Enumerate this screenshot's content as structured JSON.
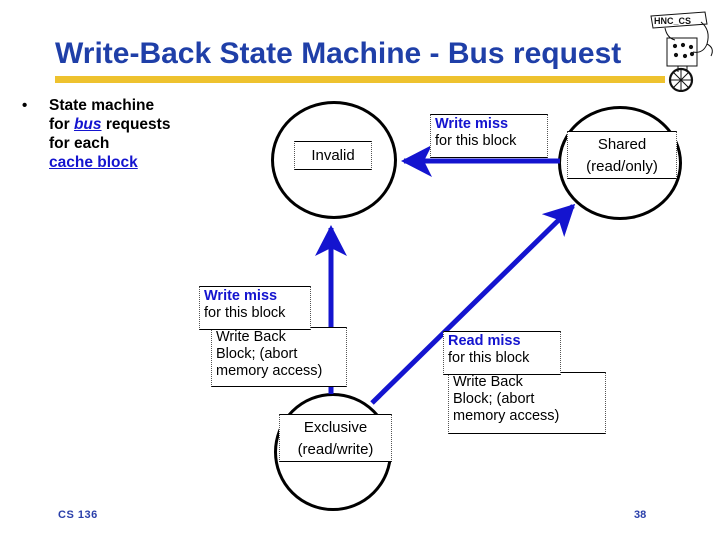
{
  "slide": {
    "title": "Write-Back State Machine - Bus request",
    "accent_rule_color": "#eec22e",
    "title_color": "#1f3fa8"
  },
  "logo": {
    "name": "hnc-cs-unicycle-logo",
    "caption": "HNC_CS"
  },
  "bullet": {
    "marker": "•",
    "line1": "State machine",
    "line2_pre": "for ",
    "line2_kw": "bus",
    "line2_post": " requests",
    "line3": " for each",
    "line4": "cache block"
  },
  "states": {
    "invalid": {
      "name": "Invalid"
    },
    "shared": {
      "line1": "Shared",
      "line2": "(read/only)"
    },
    "exclusive": {
      "line1": "Exclusive",
      "line2": "(read/write)"
    }
  },
  "annotations": {
    "write_miss_top": {
      "bold": "Write miss",
      "plain": "for this block"
    },
    "write_miss_mid": {
      "bold": "Write miss",
      "plain": "for this block"
    },
    "write_back_left": {
      "line1": "Write Back",
      "line2": "Block; (abort",
      "line3": "memory access)"
    },
    "read_miss_right": {
      "bold": "Read miss",
      "plain": "for this block"
    },
    "write_back_right": {
      "line1": "Write Back",
      "line2": "Block; (abort",
      "line3": "memory access)"
    }
  },
  "arrows": {
    "color": "#1414cf",
    "shared_to_invalid": "Shared → Invalid (write miss for this block)",
    "exclusive_to_invalid": "Exclusive → Invalid (write miss for this block / write back block, abort memory access)",
    "exclusive_to_shared": "Exclusive → Shared (read miss for this block / write back block, abort memory access)"
  },
  "footer": {
    "course": "CS 136",
    "page": "38",
    "color": "#2a3faa"
  }
}
